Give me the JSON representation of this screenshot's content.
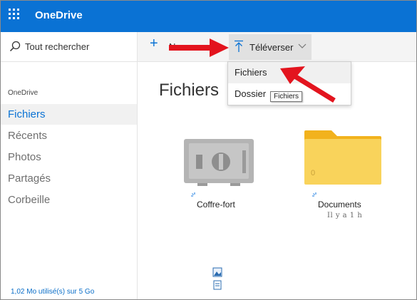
{
  "header": {
    "app_title": "OneDrive"
  },
  "sidebar": {
    "search_label": "Tout rechercher",
    "section_label": "OneDrive",
    "items": [
      {
        "label": "Fichiers",
        "active": true
      },
      {
        "label": "Récents",
        "active": false
      },
      {
        "label": "Photos",
        "active": false
      },
      {
        "label": "Partagés",
        "active": false
      },
      {
        "label": "Corbeille",
        "active": false
      }
    ],
    "quota": "1,02 Mo utilisé(s) sur 5 Go"
  },
  "commandbar": {
    "new_label": "Nouveau",
    "upload_label": "Téléverser"
  },
  "upload_menu": {
    "items": [
      "Fichiers",
      "Dossier"
    ],
    "tooltip": "Fichiers"
  },
  "main": {
    "title": "Fichiers",
    "tiles": [
      {
        "name": "Coffre-fort",
        "meta": ""
      },
      {
        "name": "Documents",
        "meta": "Il y a 1 h",
        "count": "0"
      }
    ]
  },
  "colors": {
    "brand_blue": "#0a72d4",
    "folder_yellow": "#f9d35b",
    "folder_tab": "#f2b21d",
    "arrow_red": "#e3141e"
  },
  "icons": {
    "app_launcher": "waffle-icon",
    "search": "search-icon",
    "new": "plus-icon",
    "upload": "upload-icon",
    "dropdown": "chevron-down-icon",
    "vault": "vault-icon",
    "folder": "folder-icon",
    "sync": "sync-icon"
  }
}
